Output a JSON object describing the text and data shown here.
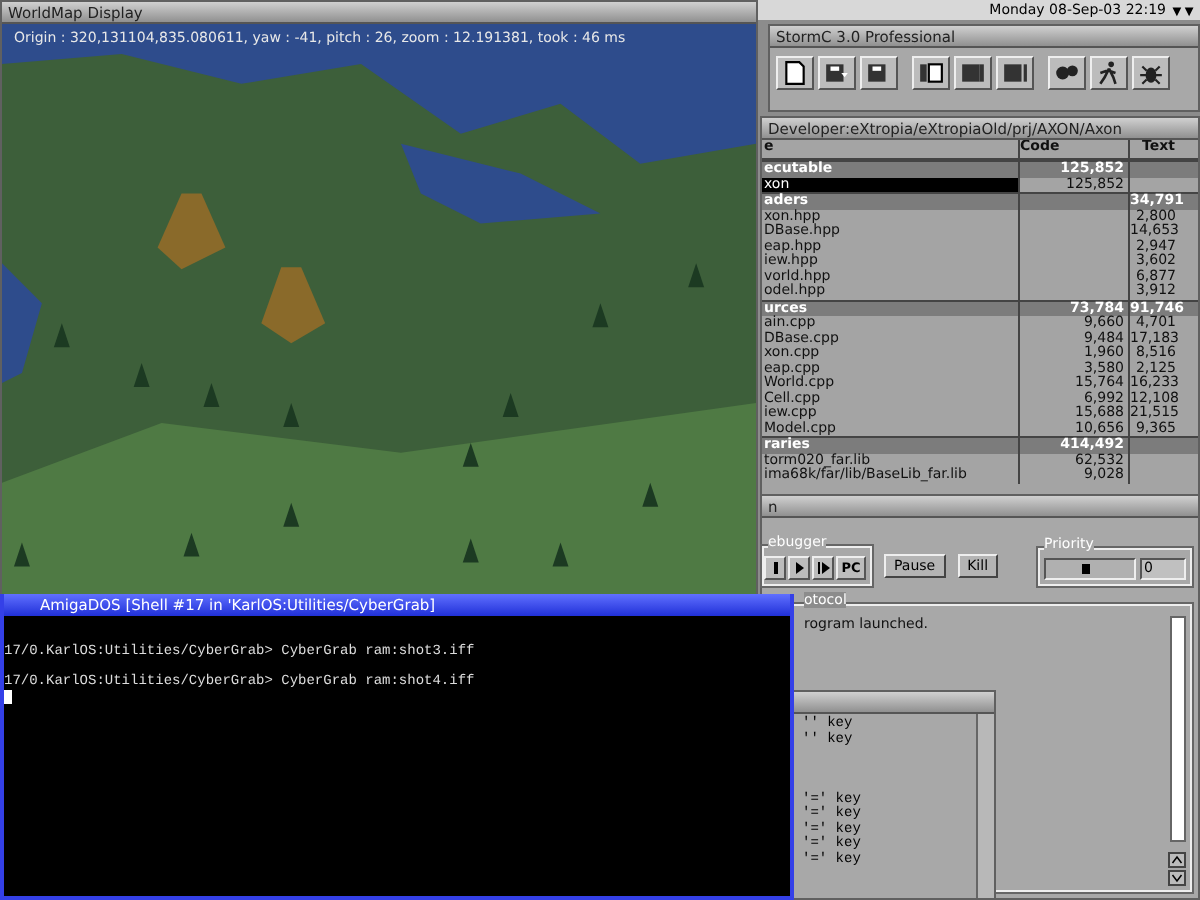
{
  "clock": "Monday 08-Sep-03 22:19",
  "worldmap": {
    "title": "WorldMap Display",
    "status": "Origin : 320,131104,835.080611, yaw : -41, pitch : 26, zoom : 12.191381, took : 46 ms"
  },
  "stormc": {
    "title": "StormC 3.0 Professional"
  },
  "project": {
    "title": "Developer:eXtropia/eXtropiaOld/prj/AXON/Axon",
    "columns": [
      "e",
      "Code",
      "Text"
    ],
    "rows": [
      {
        "kind": "group",
        "name": "ecutable",
        "code": "125,852",
        "selected": false
      },
      {
        "kind": "file",
        "name": "xon",
        "code": "125,852",
        "selected": true
      },
      {
        "kind": "group",
        "name": "aders",
        "text": "34,791",
        "selected": false
      },
      {
        "kind": "file",
        "name": "xon.hpp",
        "text": "2,800",
        "selected": false
      },
      {
        "kind": "file",
        "name": "DBase.hpp",
        "text": "14,653",
        "selected": false
      },
      {
        "kind": "file",
        "name": "eap.hpp",
        "text": "2,947",
        "selected": false
      },
      {
        "kind": "file",
        "name": "iew.hpp",
        "text": "3,602",
        "selected": false
      },
      {
        "kind": "file",
        "name": "vorld.hpp",
        "text": "6,877",
        "selected": false
      },
      {
        "kind": "file",
        "name": "odel.hpp",
        "text": "3,912",
        "selected": false
      },
      {
        "kind": "group",
        "name": "urces",
        "code": "73,784",
        "text": "91,746",
        "selected": false
      },
      {
        "kind": "file",
        "name": "ain.cpp",
        "code": "9,660",
        "text": "4,701",
        "selected": false
      },
      {
        "kind": "file",
        "name": "DBase.cpp",
        "code": "9,484",
        "text": "17,183",
        "selected": false
      },
      {
        "kind": "file",
        "name": "xon.cpp",
        "code": "1,960",
        "text": "8,516",
        "selected": false
      },
      {
        "kind": "file",
        "name": "eap.cpp",
        "code": "3,580",
        "text": "2,125",
        "selected": false
      },
      {
        "kind": "file",
        "name": "World.cpp",
        "code": "15,764",
        "text": "16,233",
        "selected": false
      },
      {
        "kind": "file",
        "name": "Cell.cpp",
        "code": "6,992",
        "text": "12,108",
        "selected": false
      },
      {
        "kind": "file",
        "name": "iew.cpp",
        "code": "15,688",
        "text": "21,515",
        "selected": false
      },
      {
        "kind": "file",
        "name": "Model.cpp",
        "code": "10,656",
        "text": "9,365",
        "selected": false
      },
      {
        "kind": "group",
        "name": "raries",
        "code": "414,492",
        "selected": false
      },
      {
        "kind": "file",
        "name": "torm020_far.lib",
        "code": "62,532",
        "selected": false
      },
      {
        "kind": "file",
        "name": "ima68k/far/lib/BaseLib_far.lib",
        "code": "9,028",
        "selected": false
      }
    ]
  },
  "debugger": {
    "title": "n",
    "group": "ebugger",
    "pc": "PC",
    "pause": "Pause",
    "kill": "Kill",
    "priority_label": "Priority",
    "priority": {
      "level": 0.45,
      "value": "0"
    }
  },
  "protocol": {
    "label": "otocol",
    "lines": [
      "rogram launched."
    ]
  },
  "shell": {
    "title": "AmigaDOS [Shell #17 in 'KarlOS:Utilities/CyberGrab]",
    "lines": [
      "17/0.KarlOS:Utilities/CyberGrab> CyberGrab ram:shot3.iff",
      "17/0.KarlOS:Utilities/CyberGrab> CyberGrab ram:shot4.iff"
    ]
  },
  "keys": {
    "lines": [
      {
        "kind": "line",
        "text": "'' key"
      },
      {
        "kind": "line",
        "text": "'' key"
      },
      {
        "kind": "blank"
      },
      {
        "kind": "blank"
      },
      {
        "kind": "blank"
      },
      {
        "kind": "line",
        "text": "'=' key"
      },
      {
        "kind": "line",
        "text": "'=' key"
      },
      {
        "kind": "line",
        "text": "'=' key"
      },
      {
        "kind": "line",
        "text": "'=' key"
      },
      {
        "kind": "line",
        "text": "'=' key"
      }
    ]
  }
}
